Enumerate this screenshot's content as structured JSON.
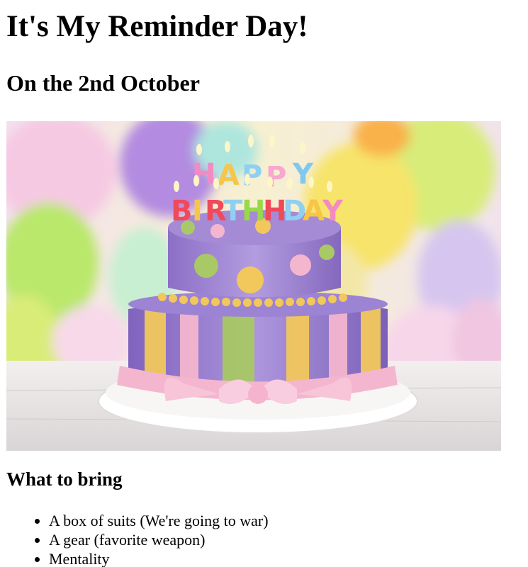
{
  "page": {
    "title": "It's My Reminder Day!",
    "date_heading": "On the 2nd October",
    "image": {
      "subject": "birthday-cake-photo",
      "cake_topper_text": "HAPPY BIRTHDAY"
    },
    "bring_section": {
      "heading": "What to bring",
      "items": [
        "A box of suits (We're going to war)",
        "A gear (favorite weapon)",
        "Mentality"
      ]
    }
  },
  "colors": {
    "text": "#000000",
    "background": "#ffffff",
    "cake_purple": "#a58ad6",
    "cake_pink": "#f4b6cf",
    "cake_yellow": "#f2c75b",
    "cake_green": "#a9c866"
  }
}
